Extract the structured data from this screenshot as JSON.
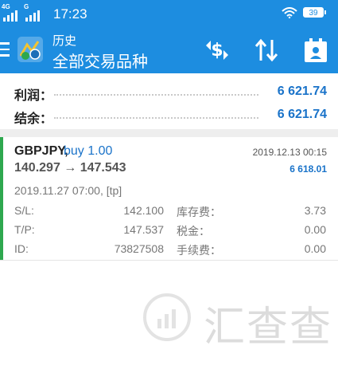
{
  "status_bar": {
    "network_left": "4G",
    "network_right": "G",
    "time": "17:23",
    "battery": "39"
  },
  "app_bar": {
    "title": "历史",
    "subtitle": "全部交易品种"
  },
  "summary": {
    "profit_label": "利润：",
    "profit_value": "6 621.74",
    "balance_label": "结余：",
    "balance_value": "6 621.74"
  },
  "order": {
    "symbol": "GBPJPY,",
    "side": "buy 1.00",
    "close_time": "2019.12.13 00:15",
    "prices": "140.297 → 147.543",
    "profit": "6 618.01",
    "open_info": "2019.11.27 07:00, [tp]",
    "sl_label": "S/L:",
    "sl_value": "142.100",
    "tp_label": "T/P:",
    "tp_value": "147.537",
    "id_label": "ID:",
    "id_value": "73827508",
    "swap_label": "库存费：",
    "swap_value": "3.73",
    "tax_label": "税金：",
    "tax_value": "0.00",
    "commission_label": "手续费：",
    "commission_value": "0.00"
  },
  "watermark": {
    "text": "汇查查"
  },
  "colors": {
    "app_bar": "#1d8de0",
    "value_blue": "#1a73c9",
    "accent_green": "#2ea84f"
  }
}
